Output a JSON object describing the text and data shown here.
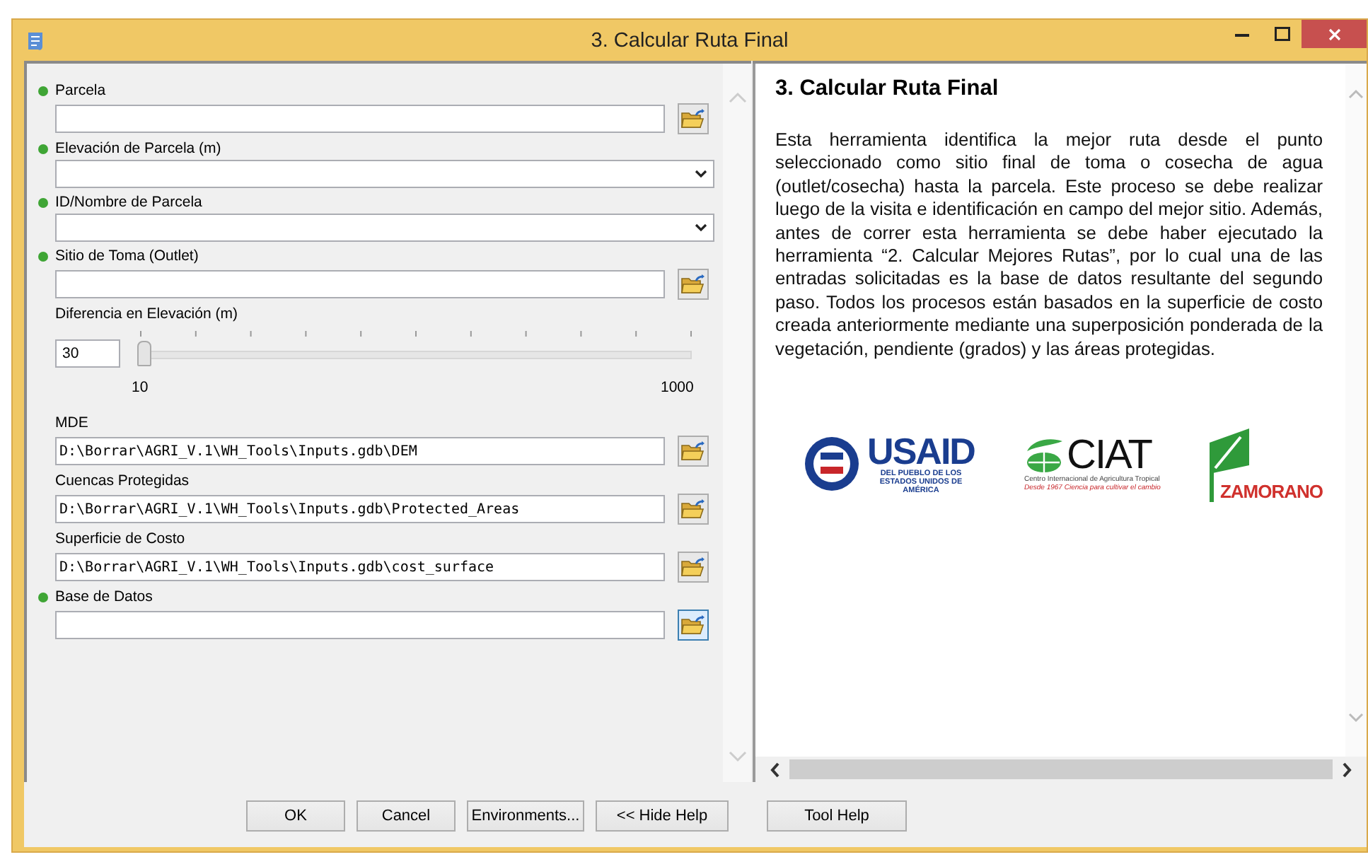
{
  "window": {
    "title": "3. Calcular Ruta Final"
  },
  "params": [
    {
      "kind": "file",
      "label": "Parcela",
      "required": true,
      "browse_focused": false
    },
    {
      "kind": "dropdown",
      "label": "Elevación de Parcela (m)",
      "required": true
    },
    {
      "kind": "dropdown",
      "label": "ID/Nombre de Parcela",
      "required": true
    },
    {
      "kind": "file",
      "label": "Sitio de Toma (Outlet)",
      "required": true,
      "browse_focused": false
    },
    {
      "kind": "slider",
      "label": "Diferencia en Elevación (m)",
      "required": false,
      "value": "30",
      "level": 0.02,
      "min_label": "10",
      "max_label": "1000"
    },
    {
      "kind": "file",
      "label": "MDE",
      "required": false,
      "value": "D:\\Borrar\\AGRI_V.1\\WH_Tools\\Inputs.gdb\\DEM",
      "browse_focused": false
    },
    {
      "kind": "file",
      "label": "Cuencas Protegidas",
      "required": false,
      "value": "D:\\Borrar\\AGRI_V.1\\WH_Tools\\Inputs.gdb\\Protected_Areas",
      "browse_focused": false
    },
    {
      "kind": "file",
      "label": "Superficie de Costo",
      "required": false,
      "value": "D:\\Borrar\\AGRI_V.1\\WH_Tools\\Inputs.gdb\\cost_surface",
      "browse_focused": false
    },
    {
      "kind": "file",
      "label": "Base de Datos",
      "required": true,
      "browse_focused": true
    }
  ],
  "buttons": [
    "OK",
    "Cancel",
    "Environments...",
    "<< Hide Help"
  ],
  "help": {
    "title": "3. Calcular Ruta Final",
    "text": "Esta herramienta identifica la mejor ruta desde el punto seleccionado como sitio final de toma o cosecha de agua (outlet/cosecha) hasta la parcela. Este proceso se debe realizar luego de la visita e identificación en campo del mejor sitio. Además, antes de correr esta herramienta se debe haber ejecutado la herramienta “2. Calcular Mejores Rutas”, por lo cual una de las entradas solicitadas es la base de datos resultante del segundo paso. Todos los procesos están basados en la superficie de costo creada anteriormente mediante una superposición ponderada de la vegetación, pendiente (grados) y las áreas protegidas.",
    "logos": [
      {
        "kind": "usaid",
        "name": "USAID",
        "caption": "DEL PUEBLO DE LOS ESTADOS UNIDOS DE AMÉRICA"
      },
      {
        "kind": "ciat",
        "name": "CIAT",
        "caption": "Centro Internacional de Agricultura Tropical",
        "tagline": "Desde 1967 Ciencia para cultivar el cambio"
      },
      {
        "kind": "zamorano",
        "name": "ZAMORANO"
      }
    ],
    "button": "Tool Help"
  }
}
